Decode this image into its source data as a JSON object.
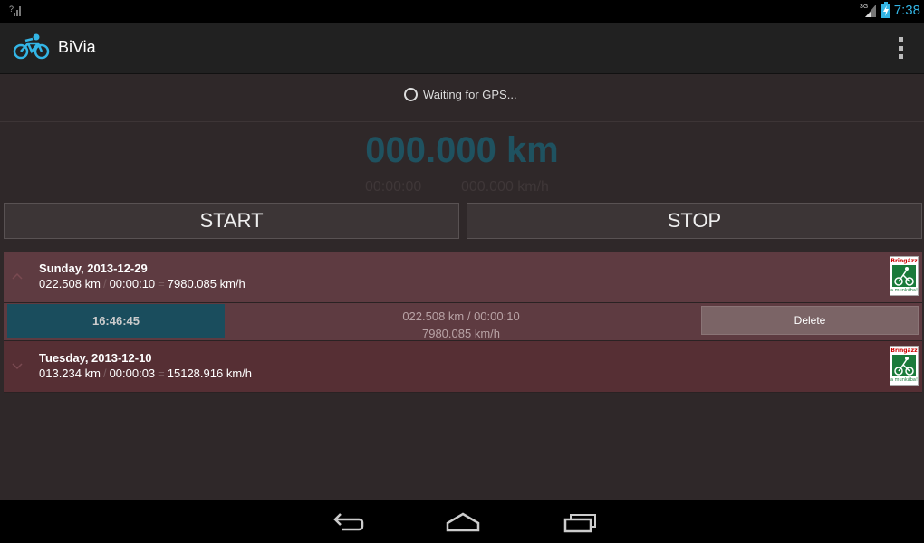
{
  "status_bar": {
    "signal_icon": "signal-unknown-icon",
    "network_label": "3G",
    "time": "7:38",
    "accent_color": "#33b5e5"
  },
  "action_bar": {
    "title": "BiVia",
    "logo_icon": "bicycle-icon",
    "menu_icon": "overflow-menu-icon"
  },
  "gps": {
    "status_text": "Waiting for GPS..."
  },
  "tracker": {
    "distance": "000.000 km",
    "elapsed": "00:00:00",
    "speed": "000.000 km/h",
    "distance_color": "#1f5260"
  },
  "controls": {
    "start_label": "START",
    "stop_label": "STOP"
  },
  "trips": [
    {
      "date": "Sunday, 2013-12-29",
      "distance": "022.508 km",
      "sep1": "/",
      "duration": "00:00:10",
      "sep2": "=",
      "speed": "7980.085 km/h",
      "expanded": true,
      "badge_top": "Bringázz",
      "badge_bottom": "a munkába!",
      "detail": {
        "time": "16:46:45",
        "line1": "022.508 km / 00:00:10",
        "line2": "7980.085 km/h",
        "delete_label": "Delete"
      }
    },
    {
      "date": "Tuesday, 2013-12-10",
      "distance": "013.234 km",
      "sep1": "/",
      "duration": "00:00:03",
      "sep2": "=",
      "speed": "15128.916 km/h",
      "expanded": false,
      "badge_top": "Bringázz",
      "badge_bottom": "a munkába!"
    }
  ],
  "nav_bar": {
    "back_icon": "back-icon",
    "home_icon": "home-icon",
    "recents_icon": "recent-apps-icon"
  }
}
